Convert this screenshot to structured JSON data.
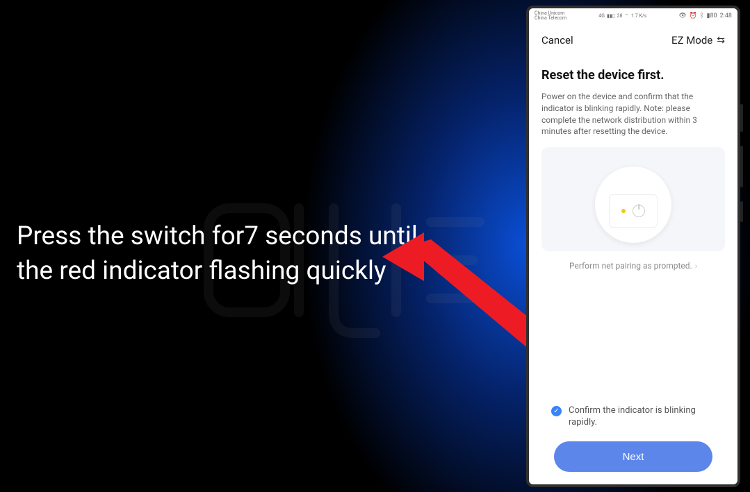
{
  "overlay": {
    "instruction": "Press the switch for7 seconds until the red indicator flashing quickly"
  },
  "phone": {
    "status": {
      "carrier1": "China Unicom",
      "carrier2": "China Telecom",
      "signal_label": "4G",
      "wifi_level": "28",
      "speed": "1.7 K/s",
      "battery_ind": "80",
      "time": "2:48"
    },
    "header": {
      "cancel": "Cancel",
      "mode": "EZ Mode"
    },
    "body": {
      "title": "Reset the device first.",
      "description": "Power on the device and confirm that the indicator is blinking rapidly.\nNote: please complete the network distribution within 3 minutes after resetting the device.",
      "pairing_link": "Perform net pairing as prompted.",
      "confirm_label": "Confirm the indicator is blinking rapidly.",
      "next_button": "Next"
    }
  }
}
